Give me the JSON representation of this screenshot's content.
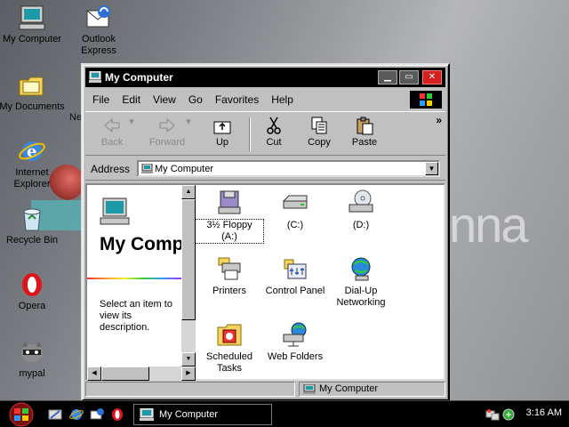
{
  "desktop": {
    "background_text": "nna",
    "partial_text": "Ne",
    "icons": [
      {
        "label": "My Computer"
      },
      {
        "label": "Outlook Express"
      },
      {
        "label": "My Documents"
      },
      {
        "label": "Internet Explorer"
      },
      {
        "label": "Recycle Bin"
      },
      {
        "label": "Opera"
      },
      {
        "label": "mypal"
      }
    ]
  },
  "window": {
    "title": "My Computer",
    "menu": [
      "File",
      "Edit",
      "View",
      "Go",
      "Favorites",
      "Help"
    ],
    "toolbar": {
      "back": "Back",
      "forward": "Forward",
      "up": "Up",
      "cut": "Cut",
      "copy": "Copy",
      "paste": "Paste",
      "more": "»"
    },
    "address": {
      "label": "Address",
      "value": "My Computer"
    },
    "left_pane": {
      "title": "My Computer",
      "description": "Select an item to view its description."
    },
    "items": [
      {
        "label": "3½ Floppy (A:)",
        "icon": "floppy-drive-icon",
        "selected": true
      },
      {
        "label": "(C:)",
        "icon": "hard-drive-icon"
      },
      {
        "label": "(D:)",
        "icon": "cd-drive-icon"
      },
      {
        "label": "Printers",
        "icon": "printers-icon"
      },
      {
        "label": "Control Panel",
        "icon": "control-panel-icon"
      },
      {
        "label": "Dial-Up Networking",
        "icon": "dialup-networking-icon"
      },
      {
        "label": "Scheduled Tasks",
        "icon": "scheduled-tasks-icon"
      },
      {
        "label": "Web Folders",
        "icon": "web-folders-icon"
      }
    ],
    "status": {
      "zone": "My Computer"
    }
  },
  "taskbar": {
    "task_button": "My Computer",
    "clock": "3:16 AM"
  },
  "colors": {
    "titlebar": "#000000",
    "face": "#c0c0c0",
    "close": "#d51f1f"
  }
}
